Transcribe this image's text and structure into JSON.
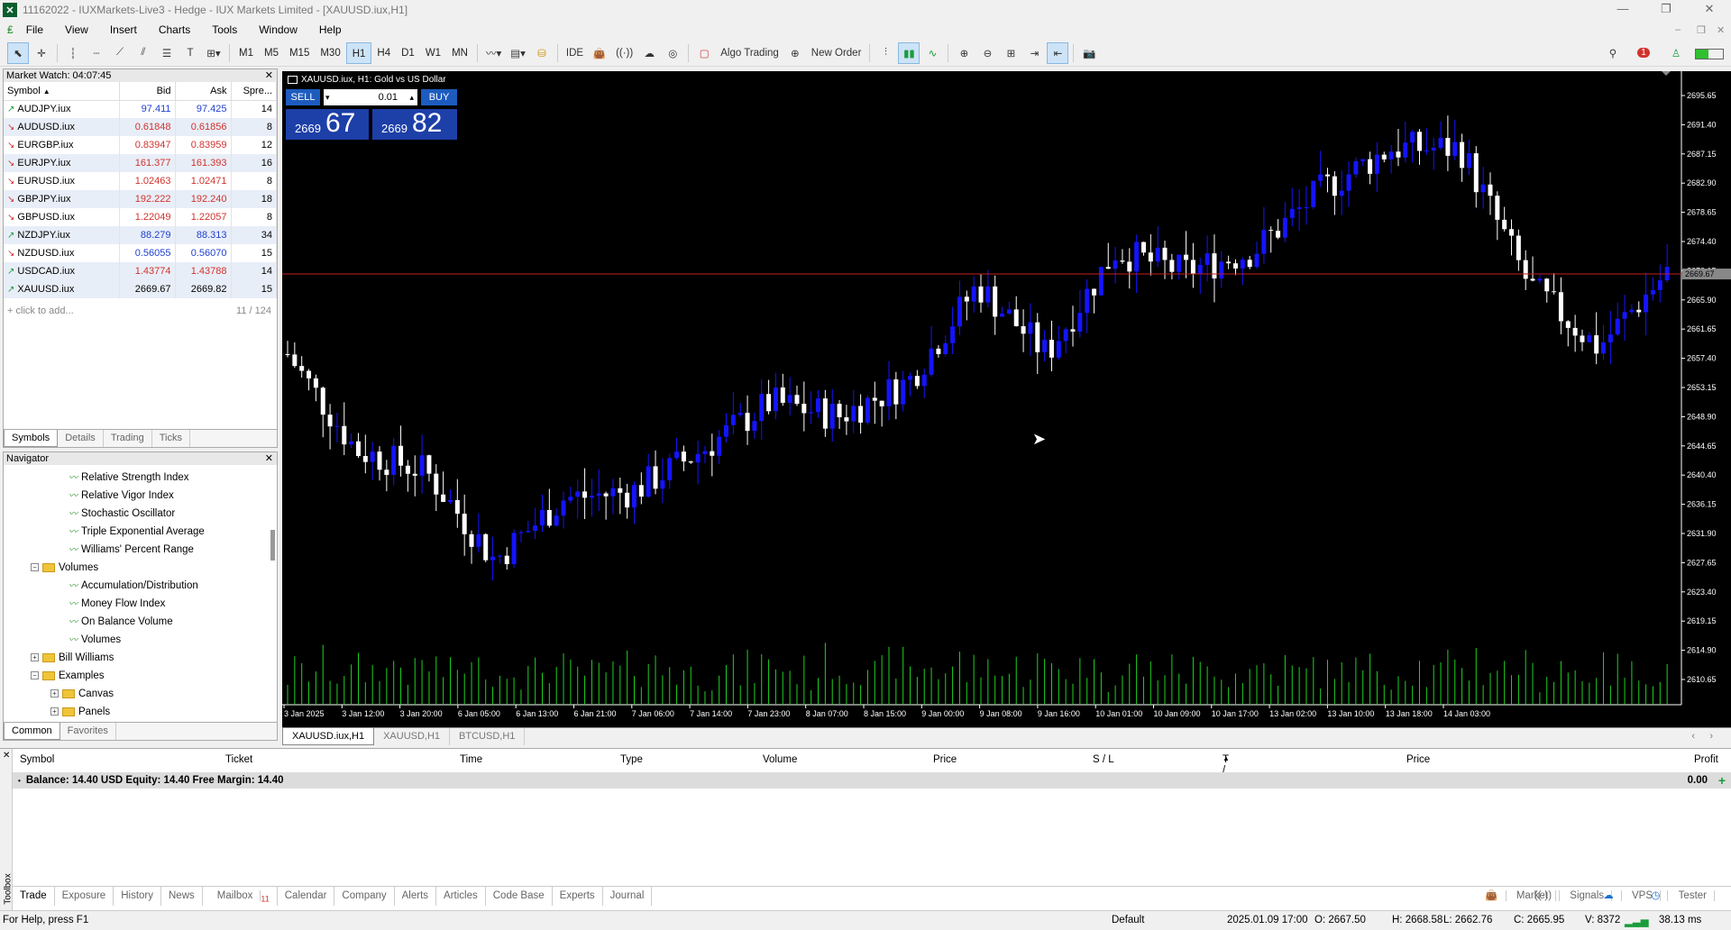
{
  "window": {
    "title": "11162022 - IUXMarkets-Live3 - Hedge - IUX Markets Limited - [XAUUSD.iux,H1]",
    "logo": "MT5 logo"
  },
  "menu": [
    "File",
    "View",
    "Insert",
    "Charts",
    "Tools",
    "Window",
    "Help"
  ],
  "toolbar": {
    "timeframes": [
      "M1",
      "M5",
      "M15",
      "M30",
      "H1",
      "H4",
      "D1",
      "W1",
      "MN"
    ],
    "selected_timeframe": "H1",
    "ide": "IDE",
    "algo_trading": "Algo Trading",
    "new_order": "New Order",
    "notification_count": "1"
  },
  "market_watch": {
    "title": "Market Watch: 04:07:45",
    "columns": [
      "Symbol",
      "Bid",
      "Ask",
      "Spre..."
    ],
    "rows": [
      {
        "symbol": "AUDJPY.iux",
        "bid": "97.411",
        "ask": "97.425",
        "spread": "14",
        "dir": "up",
        "color": "blue"
      },
      {
        "symbol": "AUDUSD.iux",
        "bid": "0.61848",
        "ask": "0.61856",
        "spread": "8",
        "dir": "down",
        "color": "red"
      },
      {
        "symbol": "EURGBP.iux",
        "bid": "0.83947",
        "ask": "0.83959",
        "spread": "12",
        "dir": "down",
        "color": "red"
      },
      {
        "symbol": "EURJPY.iux",
        "bid": "161.377",
        "ask": "161.393",
        "spread": "16",
        "dir": "down",
        "color": "red"
      },
      {
        "symbol": "EURUSD.iux",
        "bid": "1.02463",
        "ask": "1.02471",
        "spread": "8",
        "dir": "down",
        "color": "red"
      },
      {
        "symbol": "GBPJPY.iux",
        "bid": "192.222",
        "ask": "192.240",
        "spread": "18",
        "dir": "down",
        "color": "red"
      },
      {
        "symbol": "GBPUSD.iux",
        "bid": "1.22049",
        "ask": "1.22057",
        "spread": "8",
        "dir": "down",
        "color": "red"
      },
      {
        "symbol": "NZDJPY.iux",
        "bid": "88.279",
        "ask": "88.313",
        "spread": "34",
        "dir": "up",
        "color": "blue"
      },
      {
        "symbol": "NZDUSD.iux",
        "bid": "0.56055",
        "ask": "0.56070",
        "spread": "15",
        "dir": "down",
        "color": "blue"
      },
      {
        "symbol": "USDCAD.iux",
        "bid": "1.43774",
        "ask": "1.43788",
        "spread": "14",
        "dir": "up",
        "color": "red"
      },
      {
        "symbol": "XAUUSD.iux",
        "bid": "2669.67",
        "ask": "2669.82",
        "spread": "15",
        "dir": "up",
        "color": "black"
      }
    ],
    "add_hint": "click to add...",
    "count": "11 / 124",
    "tabs": [
      "Symbols",
      "Details",
      "Trading",
      "Ticks"
    ]
  },
  "navigator": {
    "title": "Navigator",
    "items": [
      {
        "label": "Relative Strength Index",
        "type": "indicator",
        "indent": 3
      },
      {
        "label": "Relative Vigor Index",
        "type": "indicator",
        "indent": 3
      },
      {
        "label": "Stochastic Oscillator",
        "type": "indicator",
        "indent": 3
      },
      {
        "label": "Triple Exponential Average",
        "type": "indicator",
        "indent": 3
      },
      {
        "label": "Williams' Percent Range",
        "type": "indicator",
        "indent": 3
      },
      {
        "label": "Volumes",
        "type": "folder-open",
        "indent": 2
      },
      {
        "label": "Accumulation/Distribution",
        "type": "indicator",
        "indent": 3
      },
      {
        "label": "Money Flow Index",
        "type": "indicator",
        "indent": 3
      },
      {
        "label": "On Balance Volume",
        "type": "indicator",
        "indent": 3
      },
      {
        "label": "Volumes",
        "type": "indicator",
        "indent": 3
      },
      {
        "label": "Bill Williams",
        "type": "folder-closed",
        "indent": 2
      },
      {
        "label": "Examples",
        "type": "folder-open",
        "indent": 2
      },
      {
        "label": "Canvas",
        "type": "folder-closed",
        "indent": 3
      },
      {
        "label": "Panels",
        "type": "folder-closed",
        "indent": 3
      }
    ],
    "tabs": [
      "Common",
      "Favorites"
    ]
  },
  "chart": {
    "title": "XAUUSD.iux, H1:  Gold vs US Dollar",
    "sell_label": "SELL",
    "buy_label": "BUY",
    "lot": "0.01",
    "sell_price_small": "2669",
    "sell_price_big": "67",
    "buy_price_small": "2669",
    "buy_price_big": "82",
    "current_price_label": "2669.67",
    "price_axis": [
      "2695.65",
      "2691.40",
      "2687.15",
      "2682.90",
      "2678.65",
      "2674.40",
      "2670.15",
      "2665.90",
      "2661.65",
      "2657.40",
      "2653.15",
      "2648.90",
      "2644.65",
      "2640.40",
      "2636.15",
      "2631.90",
      "2627.65",
      "2623.40",
      "2619.15",
      "2614.90",
      "2610.65"
    ],
    "time_axis": [
      "3 Jan 2025",
      "3 Jan 12:00",
      "3 Jan 20:00",
      "6 Jan 05:00",
      "6 Jan 13:00",
      "6 Jan 21:00",
      "7 Jan 06:00",
      "7 Jan 14:00",
      "7 Jan 23:00",
      "8 Jan 07:00",
      "8 Jan 15:00",
      "9 Jan 00:00",
      "9 Jan 08:00",
      "9 Jan 16:00",
      "10 Jan 01:00",
      "10 Jan 09:00",
      "10 Jan 17:00",
      "13 Jan 02:00",
      "13 Jan 10:00",
      "13 Jan 18:00",
      "14 Jan 03:00"
    ],
    "colors": {
      "bull": "#1414ff",
      "bear": "#ffffff",
      "volume": "#1fd11f",
      "bid_line": "#c02020",
      "background": "#000000"
    },
    "tabs": [
      "XAUUSD.iux,H1",
      "XAUUSD,H1",
      "BTCUSD,H1"
    ]
  },
  "toolbox": {
    "label": "Toolbox",
    "columns": [
      "Symbol",
      "Ticket",
      "Time",
      "Type",
      "Volume",
      "Price",
      "S / L",
      "T / P",
      "Price",
      "Profit"
    ],
    "balance": "Balance: 14.40 USD  Equity: 14.40  Free Margin: 14.40",
    "profit": "0.00",
    "tabs": [
      "Trade",
      "Exposure",
      "History",
      "News",
      "Mailbox",
      "Calendar",
      "Company",
      "Alerts",
      "Articles",
      "Code Base",
      "Experts",
      "Journal"
    ],
    "mailbox_count": "11",
    "right_buttons": [
      "Market",
      "Signals",
      "VPS",
      "Tester"
    ]
  },
  "status": {
    "help": "For Help, press F1",
    "profile": "Default",
    "datetime": "2025.01.09 17:00",
    "open": "O: 2667.50",
    "high": "H: 2668.58",
    "low": "L: 2662.76",
    "close": "C: 2665.95",
    "volume": "V: 8372",
    "ping": "38.13 ms"
  },
  "chart_data": {
    "type": "line",
    "title": "XAUUSD.iux, H1:  Gold vs US Dollar",
    "x": [
      "3 Jan 2025",
      "3 Jan 12:00",
      "3 Jan 20:00",
      "6 Jan 05:00",
      "6 Jan 13:00",
      "6 Jan 21:00",
      "7 Jan 06:00",
      "7 Jan 14:00",
      "7 Jan 23:00",
      "8 Jan 07:00",
      "8 Jan 15:00",
      "9 Jan 00:00",
      "9 Jan 08:00",
      "9 Jan 16:00",
      "10 Jan 01:00",
      "10 Jan 09:00",
      "10 Jan 17:00",
      "13 Jan 02:00",
      "13 Jan 10:00",
      "13 Jan 18:00",
      "14 Jan 03:00"
    ],
    "series": [
      {
        "values": [
          2658,
          2644,
          2641,
          2628,
          2637,
          2638,
          2644,
          2651,
          2649,
          2654,
          2668,
          2658,
          2673,
          2670,
          2673,
          2682,
          2688,
          2688,
          2668,
          2659,
          2670
        ]
      }
    ],
    "ylim": [
      2610.65,
      2695.65
    ]
  }
}
